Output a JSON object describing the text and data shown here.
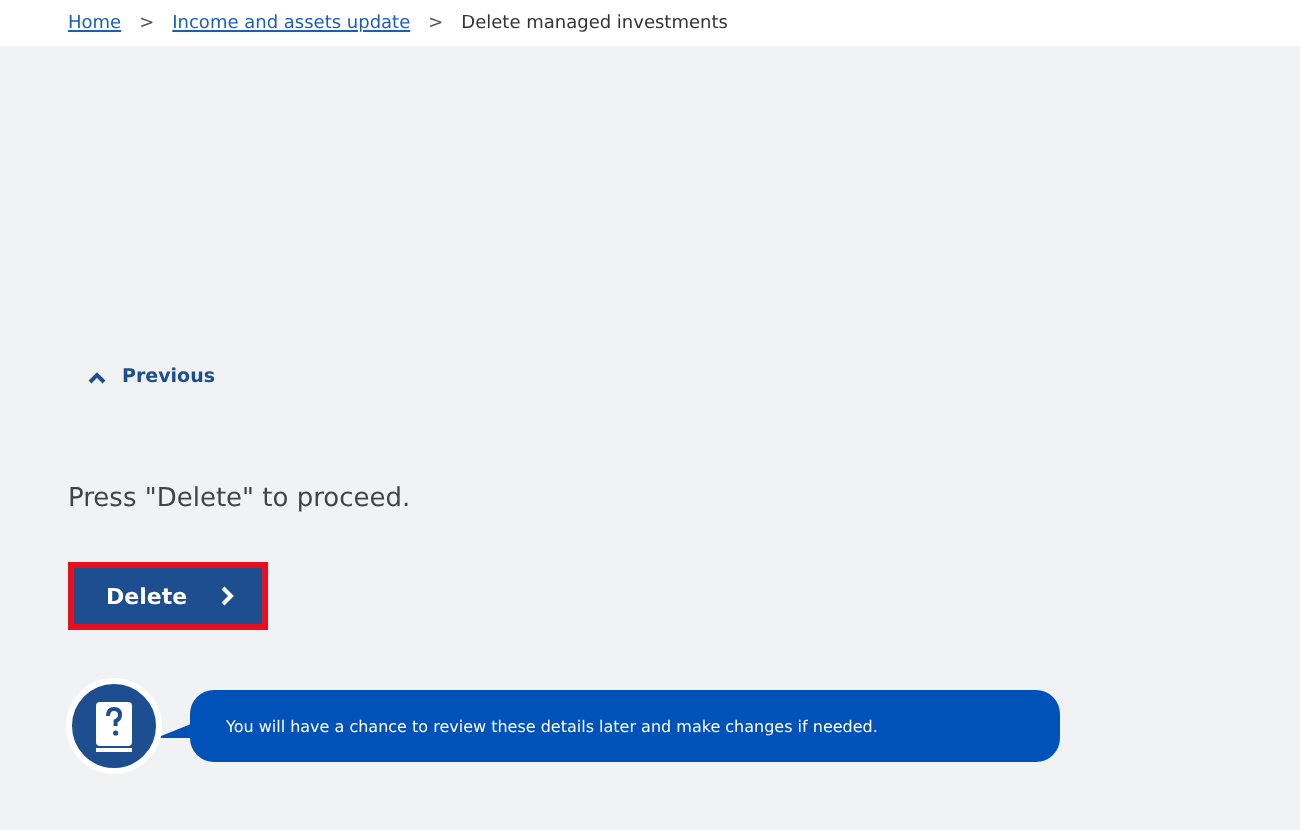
{
  "breadcrumb": [
    {
      "label": "Home",
      "link": true
    },
    {
      "label": "Income and assets update",
      "link": true
    },
    {
      "label": "Delete managed investments",
      "link": false
    }
  ],
  "breadcrumb_separator": ">",
  "previous_link": {
    "label": "Previous"
  },
  "instruction": "Press \"Delete\" to proceed.",
  "delete_button": {
    "label": "Delete",
    "highlighted": true
  },
  "help_message": "You will have a chance to review these details later and make changes if needed."
}
